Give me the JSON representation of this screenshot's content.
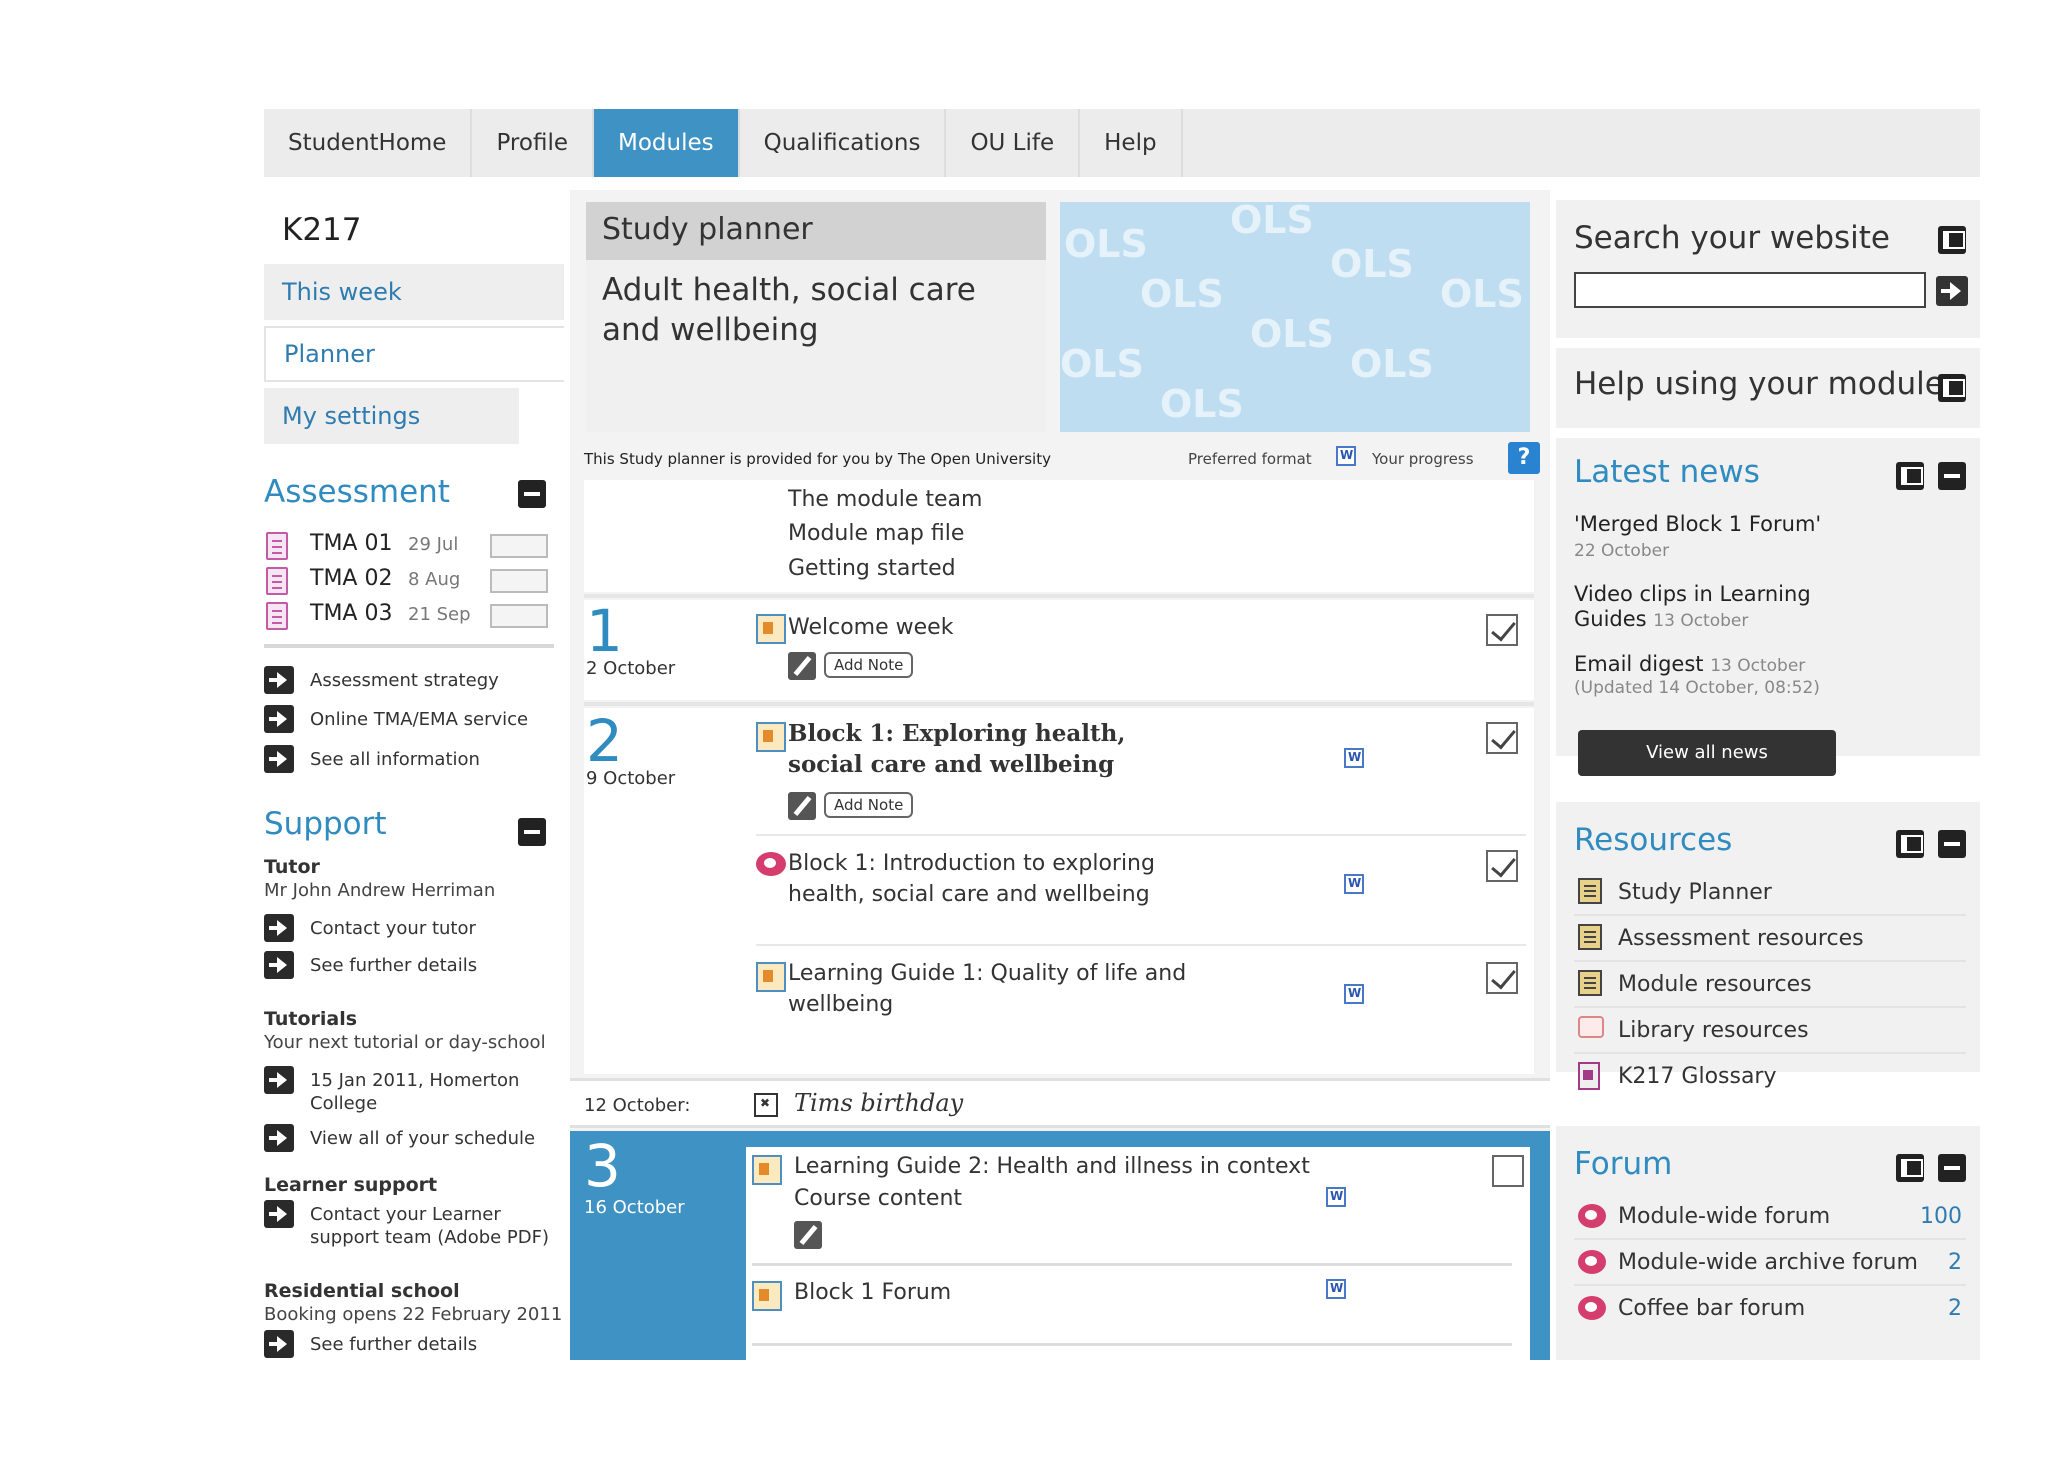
{
  "nav": {
    "tabs": [
      {
        "label": "StudentHome"
      },
      {
        "label": "Profile"
      },
      {
        "label": "Modules"
      },
      {
        "label": "Qualifications"
      },
      {
        "label": "OU Life"
      },
      {
        "label": "Help"
      }
    ],
    "active": "Modules"
  },
  "left": {
    "course_code": "K217",
    "menu": [
      {
        "label": "This week"
      },
      {
        "label": "Planner"
      },
      {
        "label": "My settings"
      }
    ],
    "assessment": {
      "title": "Assessment",
      "tmas": [
        {
          "name": "TMA 01",
          "date": "29 Jul"
        },
        {
          "name": "TMA 02",
          "date": "8 Aug"
        },
        {
          "name": "TMA 03",
          "date": "21 Sep"
        }
      ],
      "links": [
        {
          "label": "Assessment strategy"
        },
        {
          "label": "Online TMA/EMA service"
        },
        {
          "label": "See all information"
        }
      ]
    },
    "support": {
      "title": "Support",
      "tutor_label": "Tutor",
      "tutor_name": "Mr John Andrew Herriman",
      "tutor_links": [
        {
          "label": "Contact your tutor"
        },
        {
          "label": "See further details"
        }
      ],
      "tutorials_label": "Tutorials",
      "tutorials_text": "Your next tutorial or day-school",
      "tutorial_links": [
        {
          "label": "15 Jan 2011, Homerton College"
        },
        {
          "label": "View all of your schedule"
        }
      ],
      "learner_label": "Learner support",
      "learner_links": [
        {
          "label": "Contact your Learner support team (Adobe PDF)"
        }
      ],
      "residential_label": "Residential school",
      "residential_text": "Booking opens 22 February 2011",
      "residential_links": [
        {
          "label": "See further details"
        }
      ]
    }
  },
  "center": {
    "planner_header": "Study planner",
    "module_title": "Adult health, social care and wellbeing",
    "banner_text": "OLS",
    "provided_by": "This Study planner is provided for you by The Open University",
    "preferred_format": "Preferred format",
    "your_progress": "Your progress",
    "help_glyph": "?",
    "intro_items": [
      "The module team",
      "Module map file",
      "Getting started"
    ],
    "weeks": [
      {
        "number": "1",
        "date": "2 October",
        "items": [
          {
            "title": "Welcome week",
            "add_note": "Add Note",
            "checked": true
          }
        ]
      },
      {
        "number": "2",
        "date": "9 October",
        "items": [
          {
            "title": "Block 1: Exploring health, social care and wellbeing",
            "add_note": "Add Note",
            "checked": true
          },
          {
            "title": "Block 1: Introduction to exploring health, social care and wellbeing",
            "checked": true
          },
          {
            "title": "Learning Guide 1: Quality of life and wellbeing",
            "checked": true
          }
        ]
      },
      {
        "number": "3",
        "date": "16 October",
        "items": [
          {
            "title": "Learning Guide 2: Health and illness in context",
            "subtitle": "Course content",
            "checked": false
          },
          {
            "title": "Block 1 Forum"
          }
        ]
      }
    ],
    "event": {
      "date": "12 October:",
      "text": "Tims birthday"
    }
  },
  "right": {
    "search_title": "Search your website",
    "search_value": "",
    "help_title": "Help using your module",
    "news_title": "Latest news",
    "news": [
      {
        "title": "'Merged Block 1 Forum'",
        "date": "22 October"
      },
      {
        "title": "Video clips in Learning Guides",
        "date": "13 October"
      },
      {
        "title": "Email digest",
        "date": "13 October",
        "updated": "(Updated 14 October, 08:52)"
      }
    ],
    "view_all_news": "View all news",
    "resources_title": "Resources",
    "resources": [
      {
        "label": "Study Planner"
      },
      {
        "label": "Assessment resources"
      },
      {
        "label": "Module resources"
      },
      {
        "label": "Library resources"
      },
      {
        "label": "K217 Glossary"
      }
    ],
    "forum_title": "Forum",
    "forums": [
      {
        "label": "Module-wide forum",
        "count": "100"
      },
      {
        "label": "Module-wide archive forum",
        "count": "2"
      },
      {
        "label": "Coffee bar forum",
        "count": "2"
      }
    ]
  },
  "colors": {
    "accent": "#3f93c4",
    "link": "#2f7cb0",
    "heading_blue": "#2f8bc0"
  }
}
